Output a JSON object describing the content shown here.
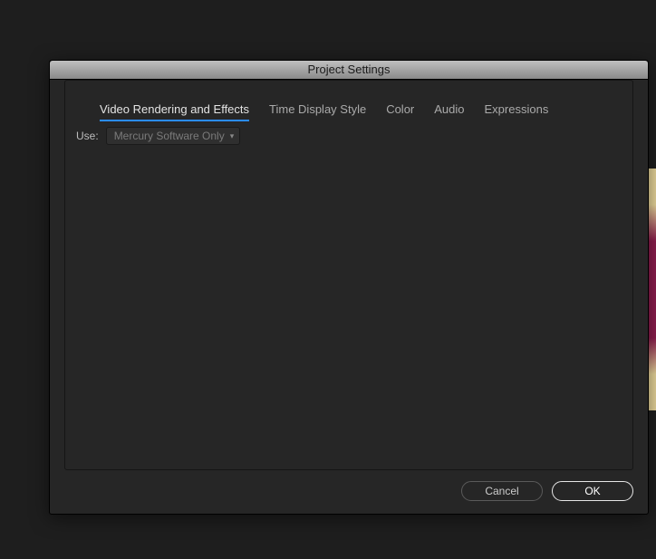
{
  "dialog": {
    "title": "Project Settings",
    "tabs": [
      {
        "label": "Video Rendering and Effects",
        "active": true
      },
      {
        "label": "Time Display Style",
        "active": false
      },
      {
        "label": "Color",
        "active": false
      },
      {
        "label": "Audio",
        "active": false
      },
      {
        "label": "Expressions",
        "active": false
      }
    ],
    "use_label": "Use:",
    "use_value": "Mercury Software Only",
    "buttons": {
      "cancel": "Cancel",
      "ok": "OK"
    }
  }
}
